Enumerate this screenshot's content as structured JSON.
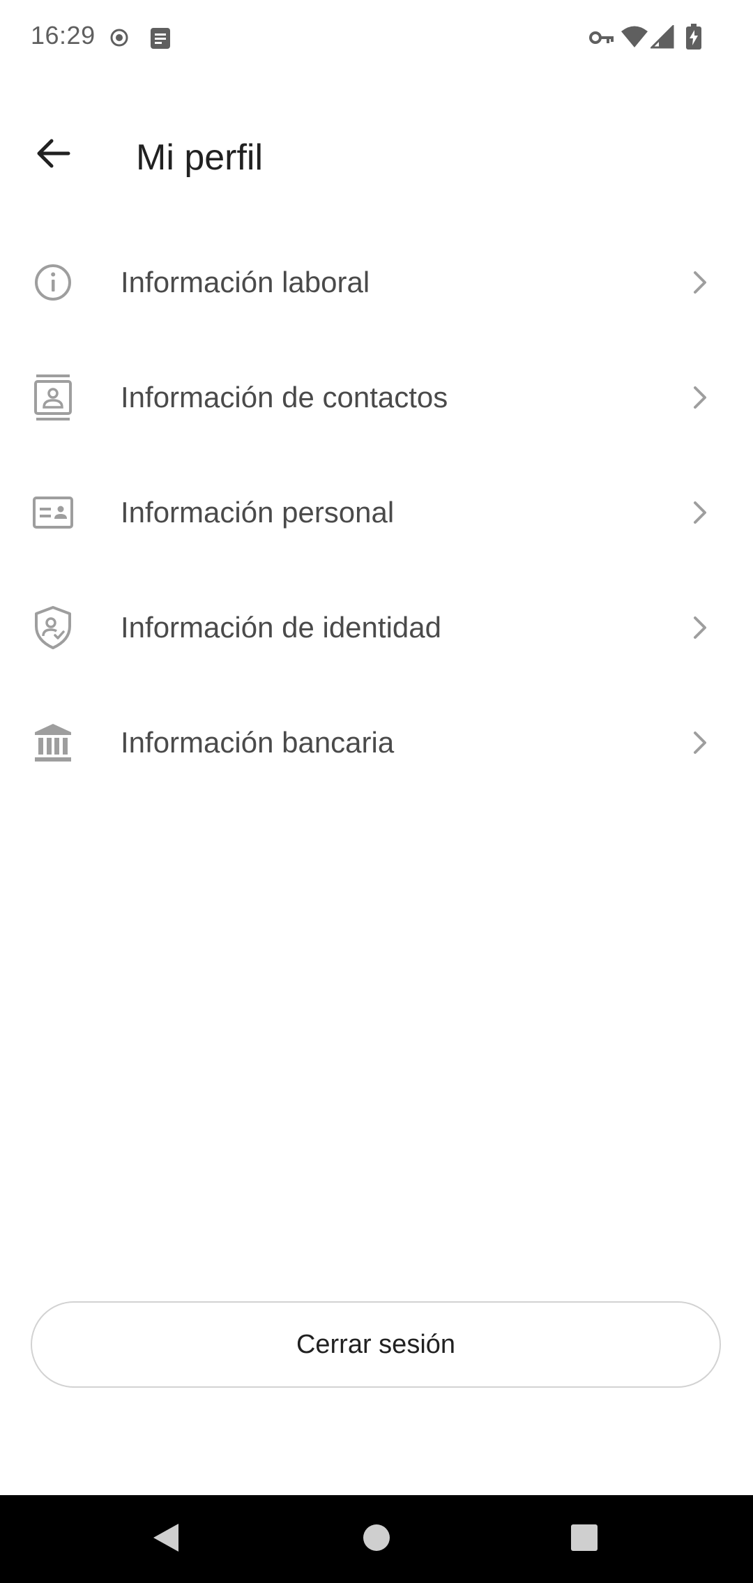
{
  "status_bar": {
    "time": "16:29",
    "icons": [
      "record-icon",
      "notes-icon",
      "vpn-key-icon",
      "wifi-icon",
      "signal-icon",
      "battery-charging-icon"
    ]
  },
  "app_bar": {
    "back_icon": "arrow-back-icon",
    "title": "Mi perfil"
  },
  "menu": {
    "items": [
      {
        "icon": "info-icon",
        "label": "Información laboral"
      },
      {
        "icon": "contacts-icon",
        "label": "Información de contactos"
      },
      {
        "icon": "id-card-icon",
        "label": "Información personal"
      },
      {
        "icon": "shield-user-icon",
        "label": "Información de identidad"
      },
      {
        "icon": "bank-icon",
        "label": "Información bancaria"
      }
    ],
    "chevron_icon": "chevron-right-icon"
  },
  "logout": {
    "label": "Cerrar sesión"
  },
  "nav_bar": {
    "back": "nav-back-icon",
    "home": "nav-home-icon",
    "recents": "nav-recents-icon"
  },
  "colors": {
    "icon_gray": "#9e9e9e",
    "text_primary": "#212121",
    "text_secondary": "#4a4a4a",
    "border": "#d2d2d2"
  }
}
